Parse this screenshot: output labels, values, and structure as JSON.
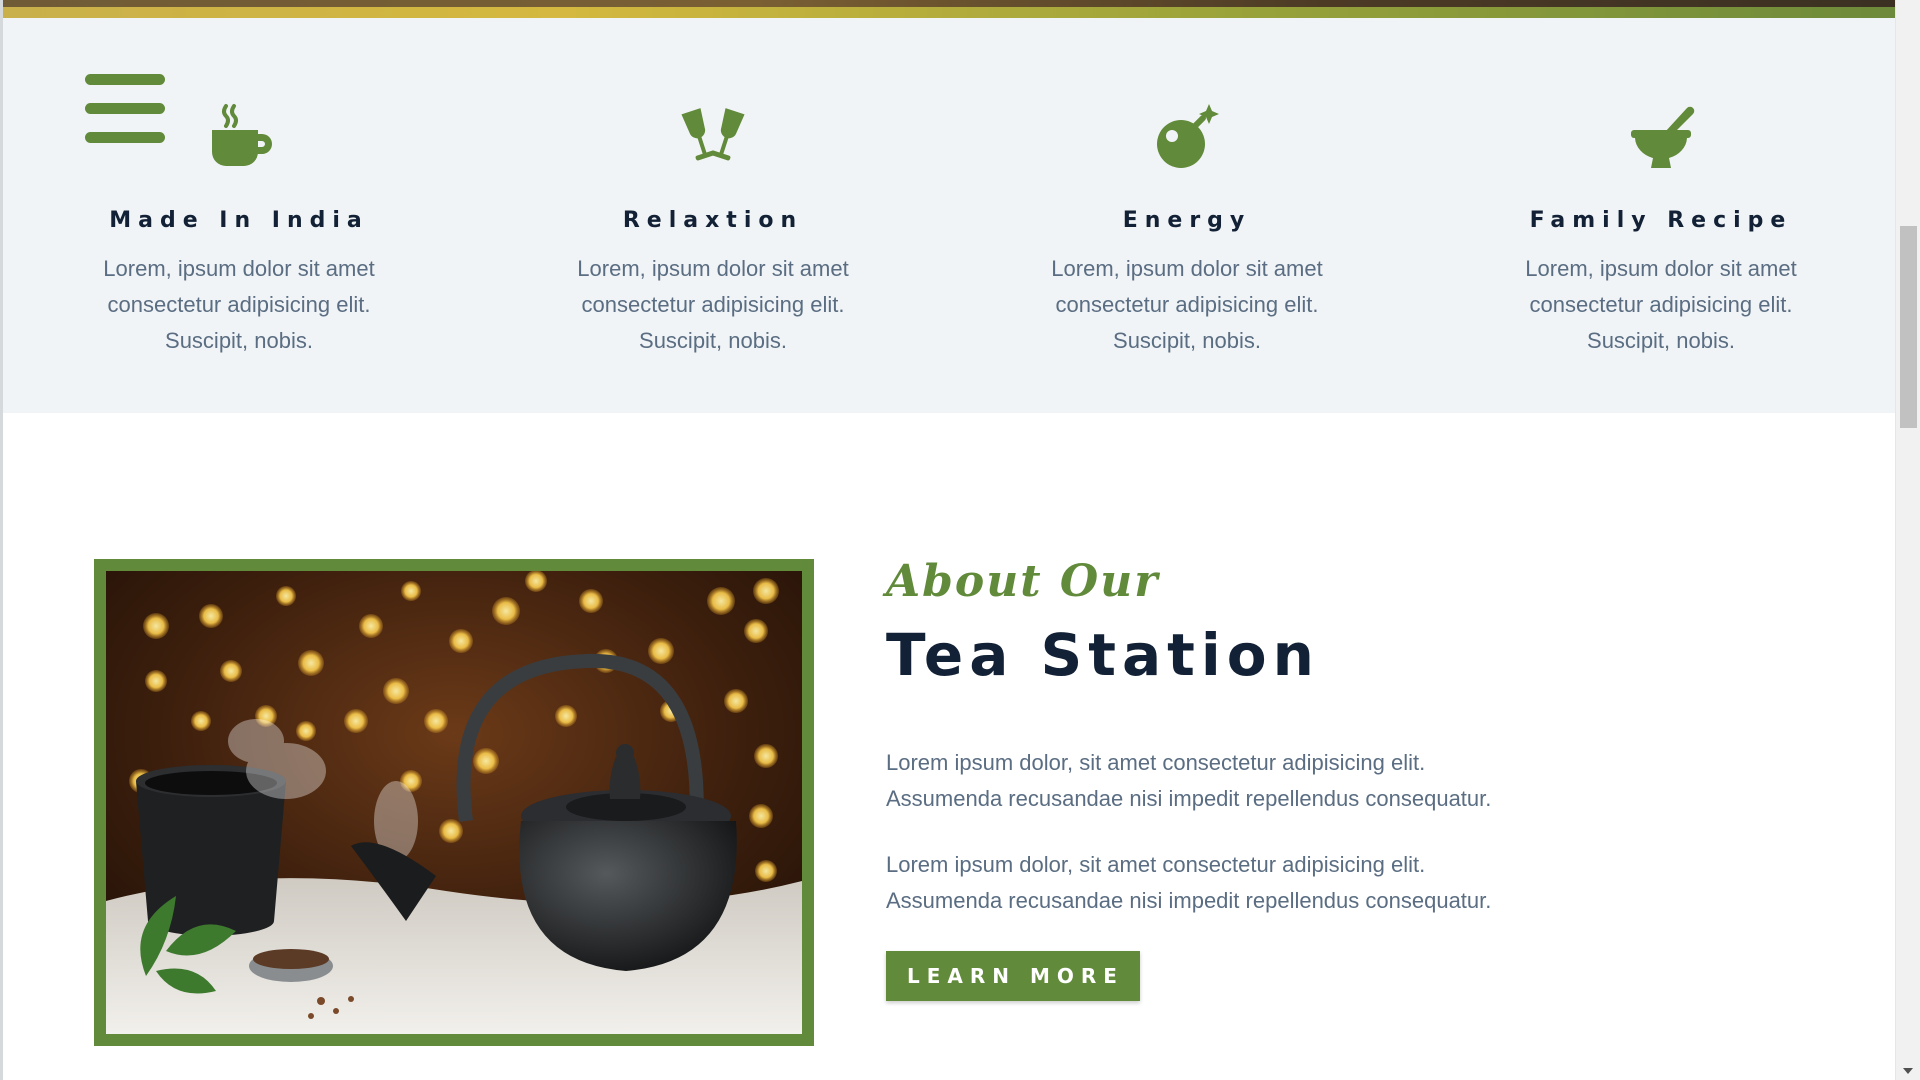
{
  "theme": {
    "accent": "#618a3a",
    "heading_color": "#122135",
    "text_color": "#5a6d82",
    "feature_bg": "#f1f4f6"
  },
  "nav": {
    "menu_icon": "hamburger-menu-icon"
  },
  "features": [
    {
      "icon": "coffee-cup-icon",
      "title": "Made In India",
      "text": "Lorem, ipsum dolor sit amet consectetur adipisicing elit. Suscipit, nobis."
    },
    {
      "icon": "toast-glasses-icon",
      "title": "Relaxtion",
      "text": "Lorem, ipsum dolor sit amet consectetur adipisicing elit. Suscipit, nobis."
    },
    {
      "icon": "bomb-icon",
      "title": "Energy",
      "text": "Lorem, ipsum dolor sit amet consectetur adipisicing elit. Suscipit, nobis."
    },
    {
      "icon": "mortar-pestle-icon",
      "title": "Family Recipe",
      "text": "Lorem, ipsum dolor sit amet consectetur adipisicing elit. Suscipit, nobis."
    }
  ],
  "about": {
    "script_heading": "About Our",
    "title": "Tea Station",
    "paragraphs": [
      "Lorem ipsum dolor, sit amet consectetur adipisicing elit. Assumenda recusandae nisi impedit repellendus consequatur.",
      "Lorem ipsum dolor, sit amet consectetur adipisicing elit. Assumenda recusandae nisi impedit repellendus consequatur."
    ],
    "button_label": "LEARN MORE",
    "image": "teapot-and-cup-photo"
  }
}
